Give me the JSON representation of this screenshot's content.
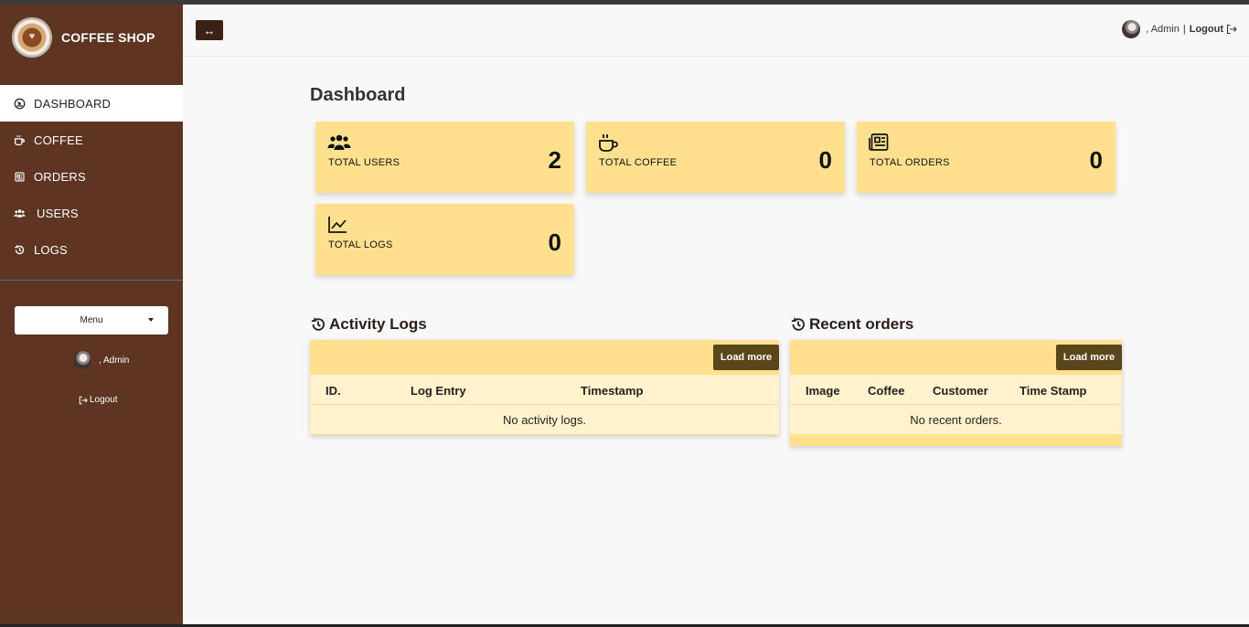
{
  "brand": {
    "title": "COFFEE SHOP"
  },
  "sidebar": {
    "items": [
      {
        "label": "DASHBOARD",
        "icon": "dashboard-icon"
      },
      {
        "label": "COFFEE",
        "icon": "coffee-icon"
      },
      {
        "label": "ORDERS",
        "icon": "orders-icon"
      },
      {
        "label": "USERS",
        "icon": "users-icon"
      },
      {
        "label": "LOGS",
        "icon": "history-icon"
      }
    ],
    "menu_select": "Menu",
    "user_name": ", Admin",
    "logout": "Logout"
  },
  "header": {
    "toggle": "↔",
    "user_name": ", Admin",
    "separator": "|",
    "logout": "Logout"
  },
  "main": {
    "title": "Dashboard",
    "cards": [
      {
        "label": "TOTAL USERS",
        "value": "2",
        "icon": "users-icon"
      },
      {
        "label": "TOTAL COFFEE",
        "value": "0",
        "icon": "coffee-icon"
      },
      {
        "label": "TOTAL ORDERS",
        "value": "0",
        "icon": "orders-icon"
      },
      {
        "label": "TOTAL LOGS",
        "value": "0",
        "icon": "chart-line-icon"
      }
    ],
    "activity": {
      "title": "Activity Logs",
      "load_more": "Load more",
      "columns": [
        "ID.",
        "Log Entry",
        "Timestamp"
      ],
      "empty": "No activity logs."
    },
    "orders": {
      "title": "Recent orders",
      "load_more": "Load more",
      "columns": [
        "Image",
        "Coffee",
        "Customer",
        "Time Stamp"
      ],
      "empty": "No recent orders."
    }
  },
  "colors": {
    "sidebar": "#5e3522",
    "card": "#ffe08f",
    "button": "#5b451b",
    "toggle": "#3b2114"
  }
}
